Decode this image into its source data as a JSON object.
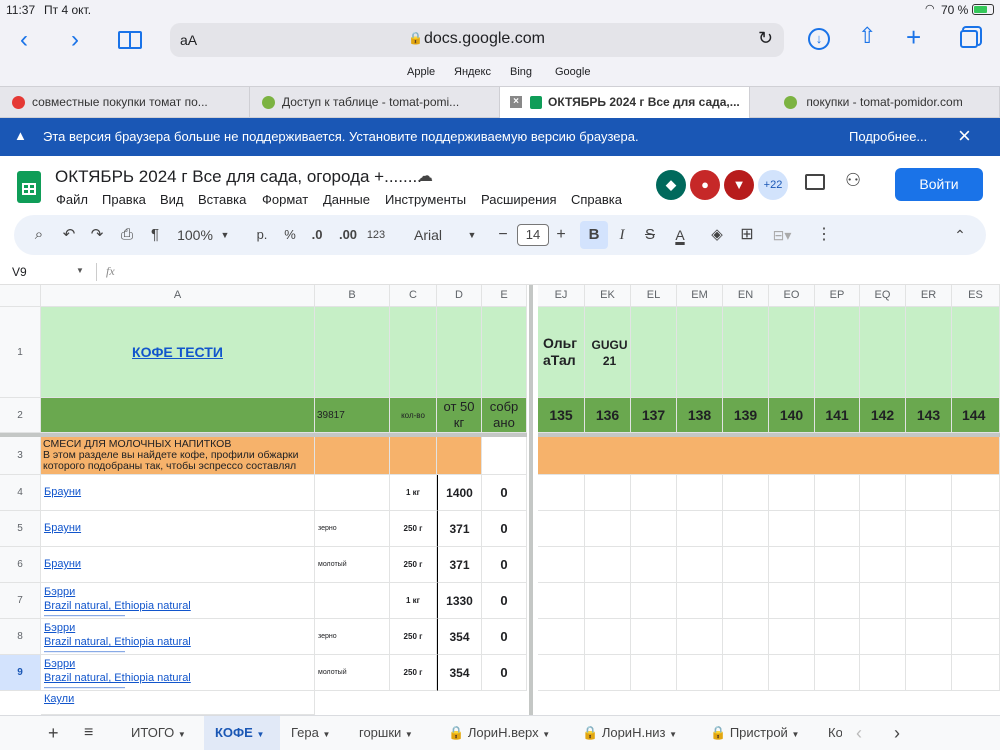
{
  "status": {
    "time": "11:37",
    "date": "Пт 4 окт.",
    "battery": "70 %"
  },
  "browser": {
    "text_size": "аА",
    "url": "docs.google.com",
    "favorites": [
      "Apple",
      "Яндекс",
      "Bing",
      "Google"
    ],
    "tabs": [
      "совместные покупки томат по...",
      "Доступ к таблице - tomat-pomi...",
      "ОКТЯБРЬ 2024 г Все для сада,...",
      "покупки - tomat-pomidor.com"
    ]
  },
  "banner": {
    "text": "Эта версия браузера больше не поддерживается. Установите поддерживаемую версию браузера.",
    "link": "Подробнее..."
  },
  "doc": {
    "title": "ОКТЯБРЬ  2024 г Все для сада, огорода +........",
    "menus": [
      "Файл",
      "Правка",
      "Вид",
      "Вставка",
      "Формат",
      "Данные",
      "Инструменты",
      "Расширения",
      "Справка"
    ],
    "more_users": "+22",
    "login": "Войти"
  },
  "toolbar": {
    "zoom": "100%",
    "currency": "р.",
    "percent": "%",
    "dec_down": ".0",
    "dec_up": ".00",
    "format": "123",
    "font": "Arial",
    "size": "14"
  },
  "formula": {
    "cell_ref": "V9",
    "fx": "fx",
    "value": ""
  },
  "colors": {
    "header_green": "#c6efc6",
    "dark_green": "#6aa84f",
    "orange": "#f6b26b",
    "link": "#1155cc",
    "accent": "#1a73e8"
  },
  "grid": {
    "columns": [
      "A",
      "B",
      "C",
      "D",
      "E",
      "EJ",
      "EK",
      "EL",
      "EM",
      "EN",
      "EO",
      "EP",
      "EQ",
      "ER",
      "ES"
    ],
    "rows": [
      "1",
      "2",
      "3",
      "4",
      "5",
      "6",
      "7",
      "8",
      "9"
    ],
    "r1": {
      "a": "КОФЕ ТЕСТИ",
      "ej": "Ольг аТал",
      "ek": "GUGU 21"
    },
    "r2": {
      "b": "39817",
      "c": "кол-во",
      "d": "от 50 кг",
      "e": "собр ано",
      "nums": [
        "135",
        "136",
        "137",
        "138",
        "139",
        "140",
        "141",
        "142",
        "143",
        "144"
      ]
    },
    "r3": {
      "a1": "СМЕСИ ДЛЯ МОЛОЧНЫХ НАПИТКОВ",
      "a2": "В этом разделе вы найдете кофе, профили обжарки",
      "a3": "которого подобраны так, чтобы эспрессо составлял"
    },
    "items": [
      {
        "name": "Брауни",
        "sub": "",
        "b": "",
        "c": "1 кг",
        "d": "1400",
        "e": "0"
      },
      {
        "name": "Брауни",
        "sub": "",
        "b": "зерно",
        "c": "250 г",
        "d": "371",
        "e": "0"
      },
      {
        "name": "Брауни",
        "sub": "",
        "b": "молотый",
        "c": "250 г",
        "d": "371",
        "e": "0"
      },
      {
        "name": "Бэрри",
        "sub": "Brazil natural, Ethiopia natural",
        "b": "",
        "c": "1 кг",
        "d": "1330",
        "e": "0"
      },
      {
        "name": "Бэрри",
        "sub": "Brazil natural, Ethiopia natural",
        "b": "зерно",
        "c": "250 г",
        "d": "354",
        "e": "0"
      },
      {
        "name": "Бэрри",
        "sub": "Brazil natural, Ethiopia natural",
        "b": "молотый",
        "c": "250 г",
        "d": "354",
        "e": "0"
      }
    ],
    "cutoff": "Каули"
  },
  "sheets": [
    "ИТОГО",
    "КОФЕ",
    "Гера",
    "горшки",
    "ЛориН.верх",
    "ЛориН.низ",
    "Пристрой",
    "Ко"
  ]
}
